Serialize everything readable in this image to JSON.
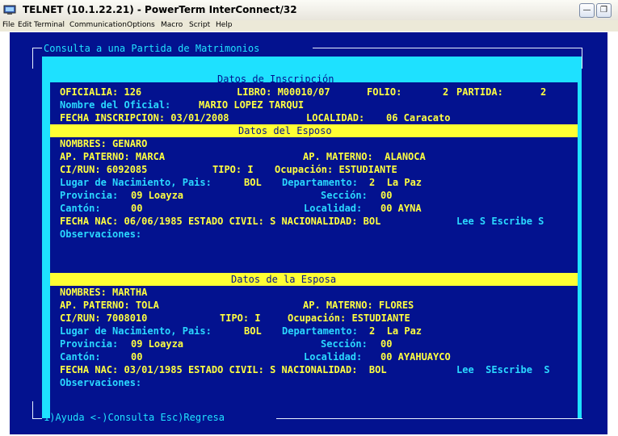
{
  "window": {
    "title": "TELNET (10.1.22.21) - PowerTerm InterConnect/32",
    "buttons": [
      "minimize",
      "restore"
    ]
  },
  "menu": [
    "File",
    "Edit",
    "Terminal",
    "Communication",
    "Options",
    "Macro",
    "Script",
    "Help"
  ],
  "screen": {
    "header_title": "Consulta a una Partida de Matrimonios",
    "inscripcion": {
      "section": "Datos de Inscripción",
      "oficialia": "OFICIALIA: 126",
      "libro": "LIBRO: M00010/07",
      "folio_label": "FOLIO:",
      "folio_value": "2",
      "partida_label": "PARTIDA:",
      "partida_value": "2",
      "nombre_label": "Nombre del Oficial:",
      "nombre_value": "MARIO LOPEZ TARQUI",
      "fecha": "FECHA INSCRIPCION: 03/01/2008",
      "localidad_label": "LOCALIDAD:",
      "localidad_value": "06 Caracato"
    },
    "esposo": {
      "section": "Datos del Esposo",
      "nombres": "NOMBRES: GENARO",
      "ap_paterno": "AP. PATERNO: MARCA",
      "ap_materno": "AP. MATERNO:  ALANOCA",
      "ci": "CI/RUN: 6092085",
      "tipo": "TIPO: I",
      "ocupacion": "Ocupación: ESTUDIANTE",
      "lugar_label": "Lugar de Nacimiento, Pais:",
      "lugar_value": "BOL",
      "depto_label": "Departamento:",
      "depto_value": "2  La Paz",
      "provincia_label": "Provincia:",
      "provincia_value": "09 Loayza",
      "seccion_label": "Sección:",
      "seccion_value": "00",
      "canton_label": "Cantón:",
      "canton_value": "00",
      "localidad_label": "Localidad:",
      "localidad_value": "00 AYNA",
      "fecha_line": "FECHA NAC: 06/06/1985 ESTADO CIVIL: S NACIONALIDAD: BOL",
      "lee_line": "Lee S Escribe S",
      "observaciones": "Observaciones:"
    },
    "esposa": {
      "section": "Datos de la Esposa",
      "nombres": "NOMBRES: MARTHA",
      "ap_paterno": "AP. PATERNO: TOLA",
      "ap_materno": "AP. MATERNO: FLORES",
      "ci": "CI/RUN: 7008010",
      "tipo": "TIPO: I",
      "ocupacion": "Ocupación: ESTUDIANTE",
      "lugar_label": "Lugar de Nacimiento, Pais:",
      "lugar_value": "BOL",
      "depto_label": "Departamento:",
      "depto_value": "2  La Paz",
      "provincia_label": "Provincia:",
      "provincia_value": "09 Loayza",
      "seccion_label": "Sección:",
      "seccion_value": "00",
      "canton_label": "Cantón:",
      "canton_value": "00",
      "localidad_label": "Localidad:",
      "localidad_value": "00 AYAHUAYCO",
      "fecha_line": "FECHA NAC: 03/01/1985 ESTADO CIVIL: S NACIONALIDAD:  BOL",
      "lee_line": "Lee  SEscribe  S",
      "observaciones": "Observaciones:"
    },
    "footer": "1)Ayuda <-)Consulta Esc)Regresa"
  },
  "colors": {
    "background": "#03128f",
    "label_cyan": "#20e3ff",
    "value_yellow": "#ffff30",
    "highlight_cyan": "#1ee1ff",
    "highlight_yellow": "#ffff33"
  }
}
